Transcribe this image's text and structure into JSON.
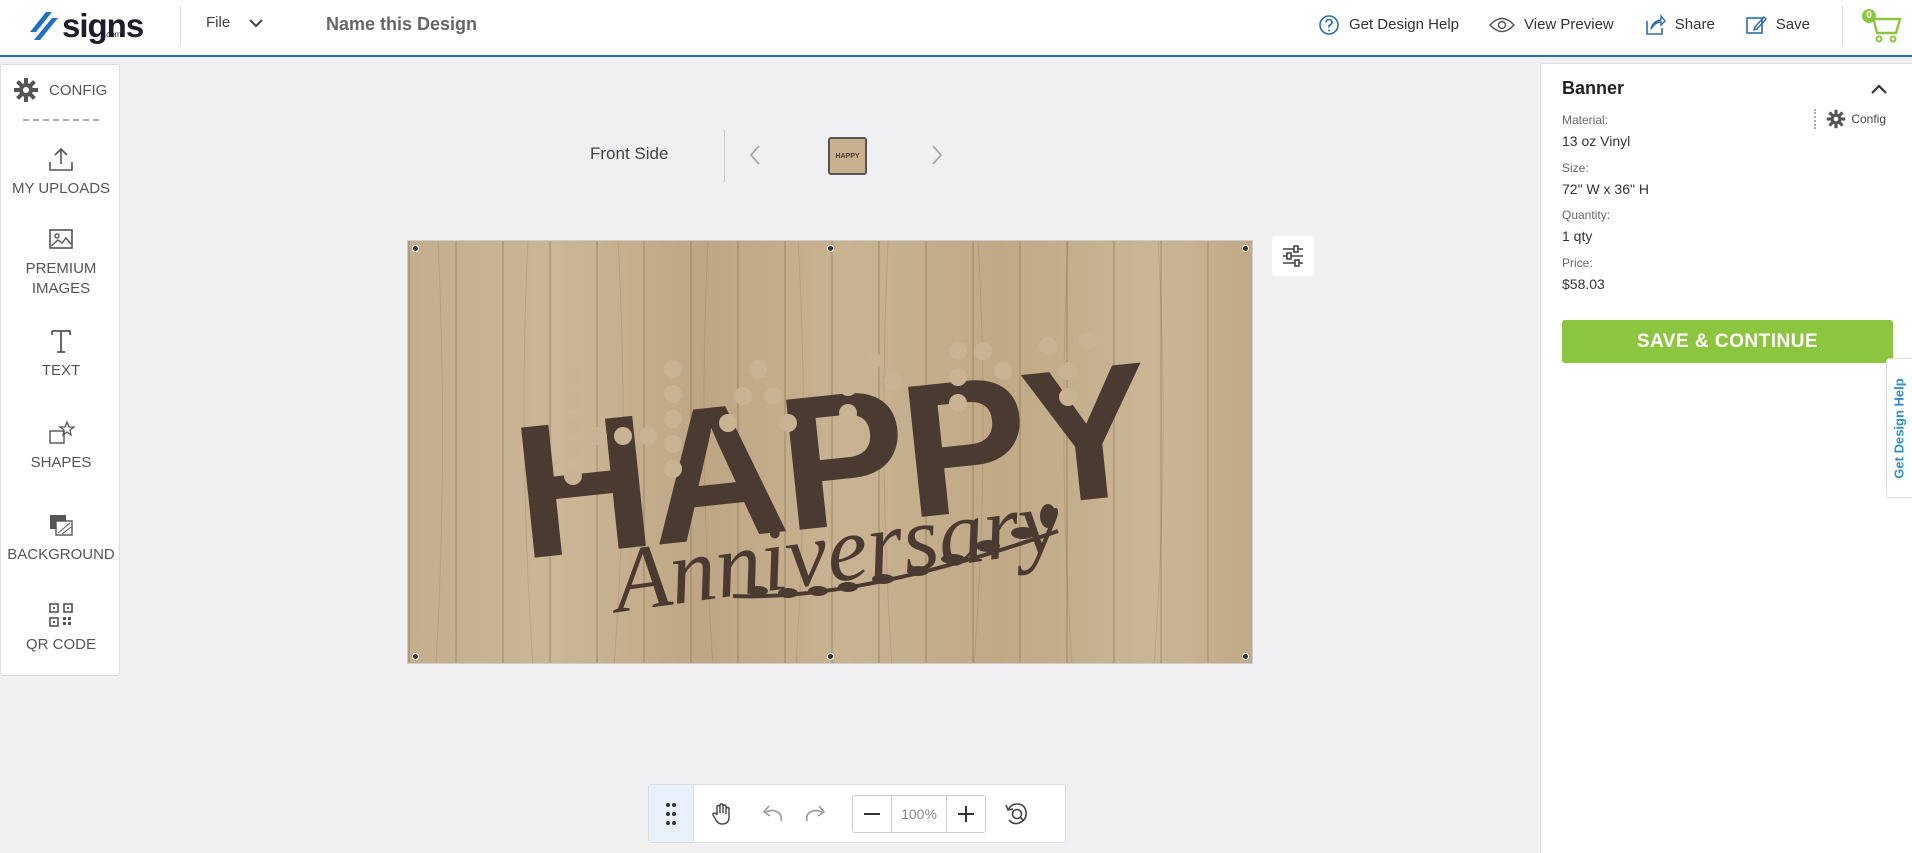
{
  "header": {
    "logo_text": "signs",
    "logo_sub": ".com",
    "file_label": "File",
    "design_name": "Name this Design",
    "actions": {
      "help": "Get Design Help",
      "preview": "View Preview",
      "share": "Share",
      "save": "Save"
    },
    "cart_count": "0"
  },
  "sidebar": {
    "config_label": "CONFIG",
    "items": [
      {
        "label": "MY UPLOADS"
      },
      {
        "label": "PREMIUM IMAGES"
      },
      {
        "label": "TEXT"
      },
      {
        "label": "SHAPES"
      },
      {
        "label": "BACKGROUND"
      },
      {
        "label": "QR CODE"
      }
    ]
  },
  "canvas": {
    "side_label": "Front Side",
    "thumb_text": "HAPPY",
    "design_text_1": "HAPPY",
    "design_text_2": "Anniversary"
  },
  "panel": {
    "title": "Banner",
    "config_label": "Config",
    "specs": [
      {
        "label": "Material:",
        "value": "13 oz Vinyl"
      },
      {
        "label": "Size:",
        "value": "72\" W x 36\" H"
      },
      {
        "label": "Quantity:",
        "value": "1 qty"
      },
      {
        "label": "Price:",
        "value": "$58.03"
      }
    ],
    "save_continue": "SAVE & CONTINUE",
    "help_tab": "Get Design Help"
  },
  "toolbar": {
    "zoom": "100%"
  },
  "colors": {
    "accent_green": "#8cc63f",
    "accent_blue": "#2a6db5",
    "design_brown": "#4a3a32"
  }
}
